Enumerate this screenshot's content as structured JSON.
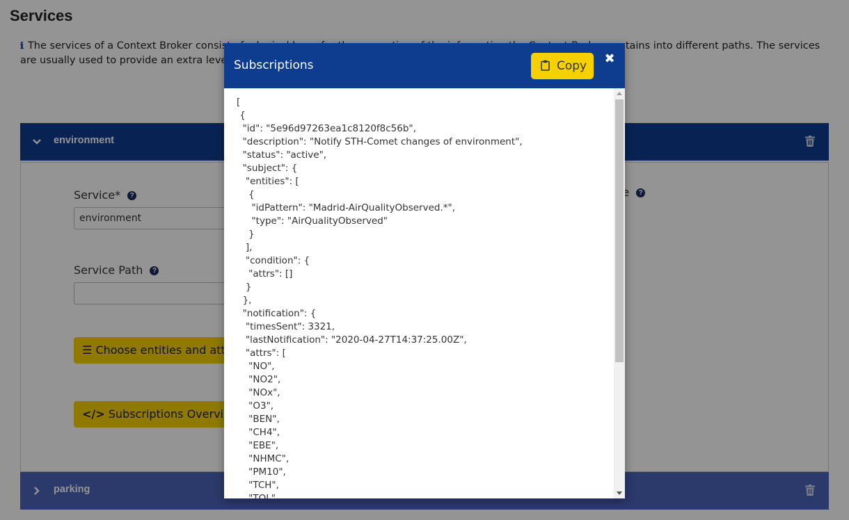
{
  "page": {
    "title": "Services",
    "info_text": "The services of a Context Broker consist of a logical layer for the separation of the information the Context Broker contains into different paths. The services are usually used to provide an extra level of security to the information."
  },
  "services": [
    {
      "name": "environment",
      "expanded": true,
      "fields": {
        "service_label": "Service*",
        "service_value": "environment",
        "service_path_label": "Service Path",
        "service_path_value": "",
        "right_label_fragment": "se"
      },
      "buttons": {
        "choose_entities": "Choose entities and attri",
        "subscriptions_overview": "Subscriptions Overview"
      }
    },
    {
      "name": "parking",
      "expanded": false
    }
  ],
  "modal": {
    "title": "Subscriptions",
    "copy_label": "Copy",
    "close_symbol": "✖",
    "json_text": "[\n {\n  \"id\": \"5e96d97263ea1c8120f8c56b\",\n  \"description\": \"Notify STH-Comet changes of environment\",\n  \"status\": \"active\",\n  \"subject\": {\n   \"entities\": [\n    {\n     \"idPattern\": \"Madrid-AirQualityObserved.*\",\n     \"type\": \"AirQualityObserved\"\n    }\n   ],\n   \"condition\": {\n    \"attrs\": []\n   }\n  },\n  \"notification\": {\n   \"timesSent\": 3321,\n   \"lastNotification\": \"2020-04-27T14:37:25.00Z\",\n   \"attrs\": [\n    \"NO\",\n    \"NO2\",\n    \"NOx\",\n    \"O3\",\n    \"BEN\",\n    \"CH4\",\n    \"EBE\",\n    \"NHMC\",\n    \"PM10\",\n    \"TCH\",\n    \"TOL\","
  },
  "colors": {
    "primary": "#0e3d8f",
    "accent_yellow": "#f7d000",
    "collapsed_header": "#4a62b8"
  }
}
